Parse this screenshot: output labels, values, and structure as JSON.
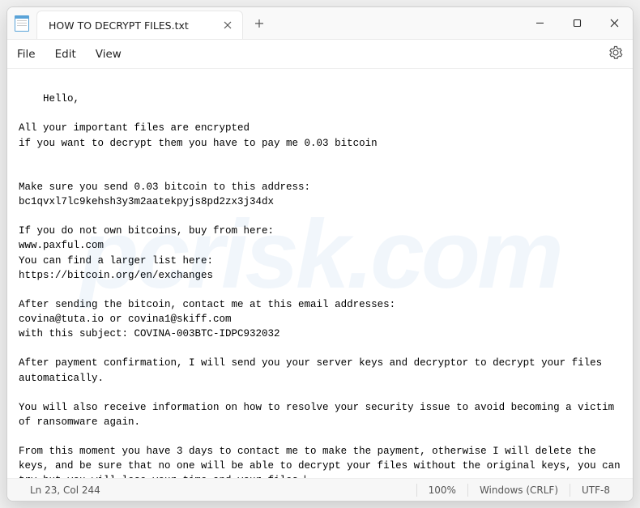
{
  "tab": {
    "title": "HOW TO DECRYPT FILES.txt"
  },
  "menu": {
    "file": "File",
    "edit": "Edit",
    "view": "View"
  },
  "body": {
    "text": "Hello,\n\nAll your important files are encrypted\nif you want to decrypt them you have to pay me 0.03 bitcoin\n\n\nMake sure you send 0.03 bitcoin to this address:\nbc1qvxl7lc9kehsh3y3m2aatekpyjs8pd2zx3j34dx\n\nIf you do not own bitcoins, buy from here:\nwww.paxful.com\nYou can find a larger list here:\nhttps://bitcoin.org/en/exchanges\n\nAfter sending the bitcoin, contact me at this email addresses:\ncovina@tuta.io or covina1@skiff.com\nwith this subject: COVINA-003BTC-IDPC932032\n\nAfter payment confirmation, I will send you your server keys and decryptor to decrypt your files automatically.\n\nYou will also receive information on how to resolve your security issue to avoid becoming a victim of ransomware again.\n\nFrom this moment you have 3 days to contact me to make the payment, otherwise I will delete the keys, and be sure that no one will be able to decrypt your files without the original keys, you can try but you will lose your time and your files."
  },
  "status": {
    "position": "Ln 23, Col 244",
    "zoom": "100%",
    "eol": "Windows (CRLF)",
    "encoding": "UTF-8"
  },
  "watermark": "pcrisk.com"
}
